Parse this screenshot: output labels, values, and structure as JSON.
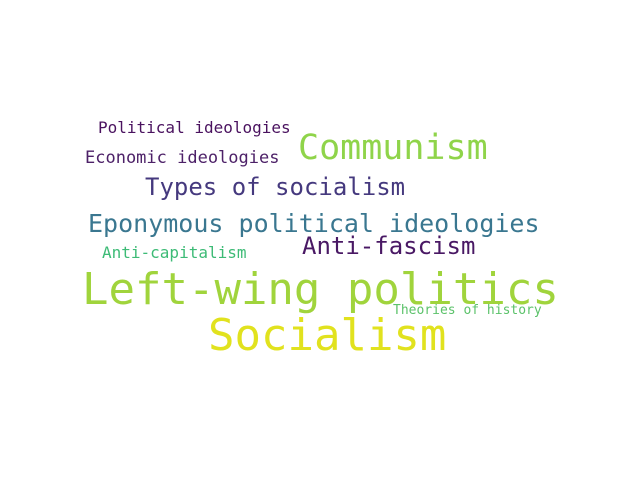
{
  "words": [
    {
      "key": "left_wing_politics",
      "text": "Left-wing politics",
      "color": "#a0d43c"
    },
    {
      "key": "socialism",
      "text": "Socialism",
      "color": "#e1e21e"
    },
    {
      "key": "communism",
      "text": "Communism",
      "color": "#8fd44a"
    },
    {
      "key": "eponymous",
      "text": "Eponymous political ideologies",
      "color": "#3a7790"
    },
    {
      "key": "types_of_socialism",
      "text": "Types of socialism",
      "color": "#45397e"
    },
    {
      "key": "anti_fascism",
      "text": "Anti-fascism",
      "color": "#491864"
    },
    {
      "key": "economic_ideologies",
      "text": "Economic ideologies",
      "color": "#4d2168"
    },
    {
      "key": "political_ideologies",
      "text": "Political ideologies",
      "color": "#4a125f"
    },
    {
      "key": "anti_capitalism",
      "text": "Anti-capitalism",
      "color": "#3dbb76"
    },
    {
      "key": "theories_of_history",
      "text": "Theories of history",
      "color": "#5bc26a"
    }
  ]
}
